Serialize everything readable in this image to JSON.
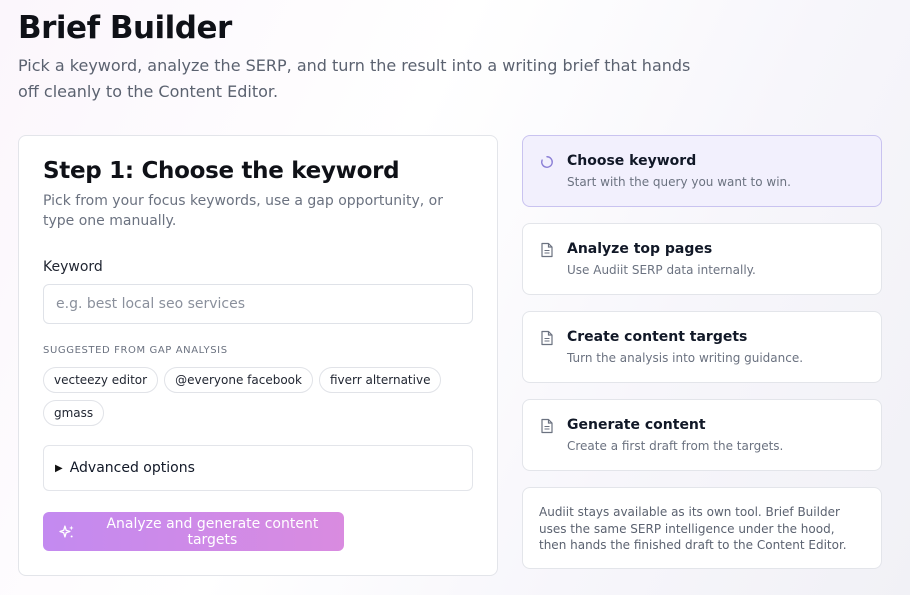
{
  "header": {
    "title": "Brief Builder",
    "subtitle": "Pick a keyword, analyze the SERP, and turn the result into a writing brief that hands off cleanly to the Content Editor."
  },
  "step_card": {
    "title": "Step 1: Choose the keyword",
    "description": "Pick from your focus keywords, use a gap opportunity, or type one manually.",
    "keyword_label": "Keyword",
    "keyword_value": "",
    "keyword_placeholder": "e.g. best local seo services",
    "suggestions_heading": "SUGGESTED FROM GAP ANALYSIS",
    "suggestions": [
      "vecteezy editor",
      "@everyone facebook",
      "fiverr alternative",
      "gmass"
    ],
    "advanced_label": "Advanced options",
    "analyze_button": "Analyze and generate content targets"
  },
  "steps": [
    {
      "title": "Choose keyword",
      "description": "Start with the query you want to win.",
      "icon": "spinner-icon",
      "active": true
    },
    {
      "title": "Analyze top pages",
      "description": "Use Audiit SERP data internally.",
      "icon": "document-icon",
      "active": false
    },
    {
      "title": "Create content targets",
      "description": "Turn the analysis into writing guidance.",
      "icon": "document-icon",
      "active": false
    },
    {
      "title": "Generate content",
      "description": "Create a first draft from the targets.",
      "icon": "document-icon",
      "active": false
    }
  ],
  "note": "Audiit stays available as its own tool. Brief Builder uses the same SERP intelligence under the hood, then hands the finished draft to the Content Editor.",
  "colors": {
    "accent_gradient_start": "#c38af0",
    "accent_gradient_end": "#d98be0",
    "active_step_bg": "#f2f0fd",
    "active_step_border": "#c9c3f0"
  }
}
